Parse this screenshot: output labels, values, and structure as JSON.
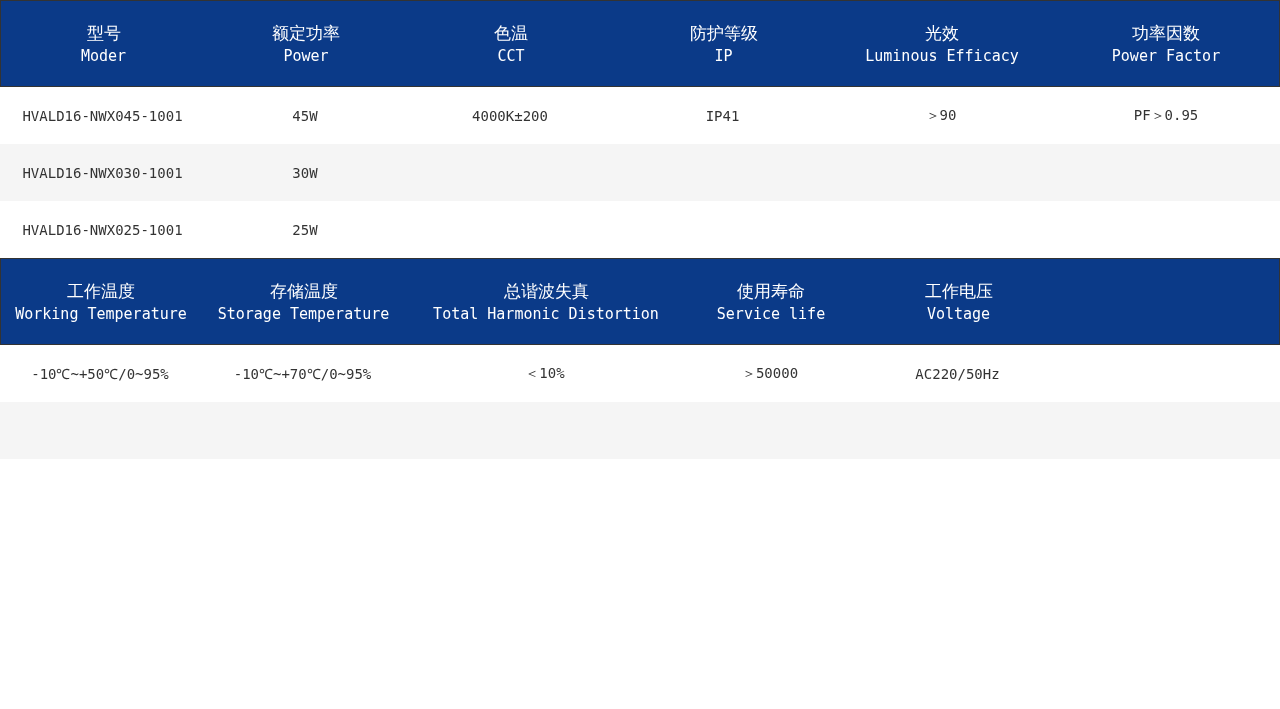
{
  "spec_table_1": {
    "columns": [
      {
        "zh": "型号",
        "en": "Moder"
      },
      {
        "zh": "额定功率",
        "en": "Power"
      },
      {
        "zh": "色温",
        "en": "CCT"
      },
      {
        "zh": "防护等级",
        "en": "IP"
      },
      {
        "zh": "光效",
        "en": "Luminous Efficacy"
      },
      {
        "zh": "功率因数",
        "en": "Power Factor"
      }
    ],
    "rows": [
      [
        "HVALD16-NWX045-1001",
        "45W",
        "4000K±200",
        "IP41",
        "＞90",
        "PF＞0.95"
      ],
      [
        "HVALD16-NWX030-1001",
        "30W"
      ],
      [
        "HVALD16-NWX025-1001",
        "25W"
      ]
    ]
  },
  "spec_table_2": {
    "columns": [
      {
        "zh": "工作温度",
        "en": "Working Temperature"
      },
      {
        "zh": "存储温度",
        "en": "Storage Temperature"
      },
      {
        "zh": "总谐波失真",
        "en": "Total Harmonic Distortion"
      },
      {
        "zh": "使用寿命",
        "en": "Service life"
      },
      {
        "zh": "工作电压",
        "en": "Voltage"
      }
    ],
    "rows": [
      [
        "-10℃~+50℃/0~95%",
        "-10℃~+70℃/0~95%",
        "＜10%",
        "＞50000",
        "AC220/50Hz"
      ]
    ]
  }
}
